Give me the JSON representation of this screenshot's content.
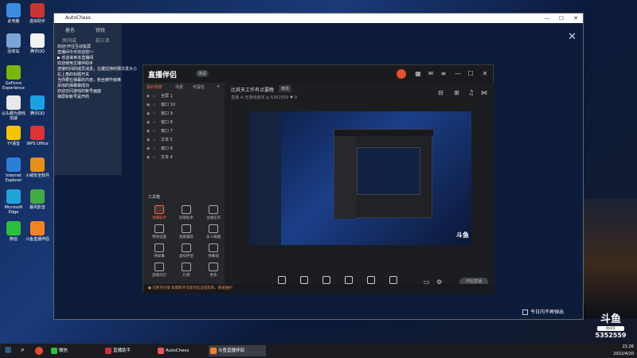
{
  "desktop": {
    "icons": [
      {
        "label": "此电脑",
        "color": "#3b8de0"
      },
      {
        "label": "虚拟助手",
        "color": "#c33"
      },
      {
        "label": "回收站",
        "color": "#7aa6d6"
      },
      {
        "label": "腾讯QQ",
        "color": "#f2f2f2"
      },
      {
        "label": "GeForce Experience",
        "color": "#76b900"
      },
      {
        "label": "以头都为游戏加速",
        "color": "#e8e8e8"
      },
      {
        "label": "腾讯QQ",
        "color": "#1ba1e2"
      },
      {
        "label": "YY语音",
        "color": "#f5c400"
      },
      {
        "label": "WPS Office",
        "color": "#d33"
      },
      {
        "label": "Internet Explorer",
        "color": "#2b7fd8"
      },
      {
        "label": "火绒安全软件",
        "color": "#e88f1a"
      },
      {
        "label": "Microsoft Edge",
        "color": "#1fa4d8"
      },
      {
        "label": "暴风影音",
        "color": "#4a4"
      },
      {
        "label": "微信",
        "color": "#2dbe3c"
      },
      {
        "label": "斗鱼直播伴侣",
        "color": "#f58220"
      },
      {
        "label": "哥布兰",
        "color": "#333"
      }
    ]
  },
  "autochess": {
    "title": "AutoChess",
    "chat": {
      "header": [
        "着色",
        "锐锐"
      ],
      "tabs": [
        "房间成",
        "前三名"
      ],
      "lines": [
        "欢迎!开往互动投屏",
        "直播间今天欢迎您!~",
        "▶ 欢迎来到本直播间",
        "欢迎使用主播伴助手",
        "连接时间的成员消息，左键拉持的那次发大小",
        "右上角的标题开关",
        "当你要在弹幕的内容，粉丝牌升级等",
        "添加的弹幕做成功",
        "欢迎访问游戏的帐号画面",
        "弹屏和帐号是开的"
      ]
    }
  },
  "live_assistant": {
    "logo": "直播伴侣",
    "version": "测试",
    "tabs": [
      "我的场景",
      "场景",
      "可提名"
    ],
    "scenes": [
      "全屏 1",
      "窗口 10",
      "窗口 9",
      "窗口 8",
      "窗口 7",
      "文本 5",
      "窗口 6",
      "文本 4"
    ],
    "tools_header": "工具箱",
    "tools": [
      "弹幕助手",
      "房管助手",
      "主播任务",
      "特效设置",
      "观看跟踪",
      "多人联播",
      "弹屏幕",
      "虚拟伴侣",
      "弹幕墙",
      "直播日历",
      "礼物",
      "更多"
    ],
    "room_title": "比其天工作有点要晚",
    "room_edit": "修改",
    "room_meta": "直播  ⊘  无游戏房间  ◎  5352559  ♥ 0",
    "bottom_buttons": [
      "直播屏幕",
      "摄像头",
      "手机投屏",
      "多媒体",
      "麦克风",
      "扬声器"
    ],
    "start_label": "开始直播",
    "status": "● 已断开连接    如需断开可能对您造成影响，数据维护"
  },
  "overlay": {
    "no_popup": "今日内不再弹出",
    "douyu_brand": "斗鱼",
    "douyu_room_label": "房间号",
    "douyu_room": "5352559"
  },
  "taskbar": {
    "items": [
      {
        "label": "微信",
        "color": "#2dbe3c"
      },
      {
        "label": "直播助手",
        "color": "#c33"
      },
      {
        "label": "AutoChess",
        "color": "#e55"
      },
      {
        "label": "斗鱼直播伴侣",
        "color": "#f58220"
      }
    ],
    "time": "21:26",
    "date": "2022/4/20"
  }
}
